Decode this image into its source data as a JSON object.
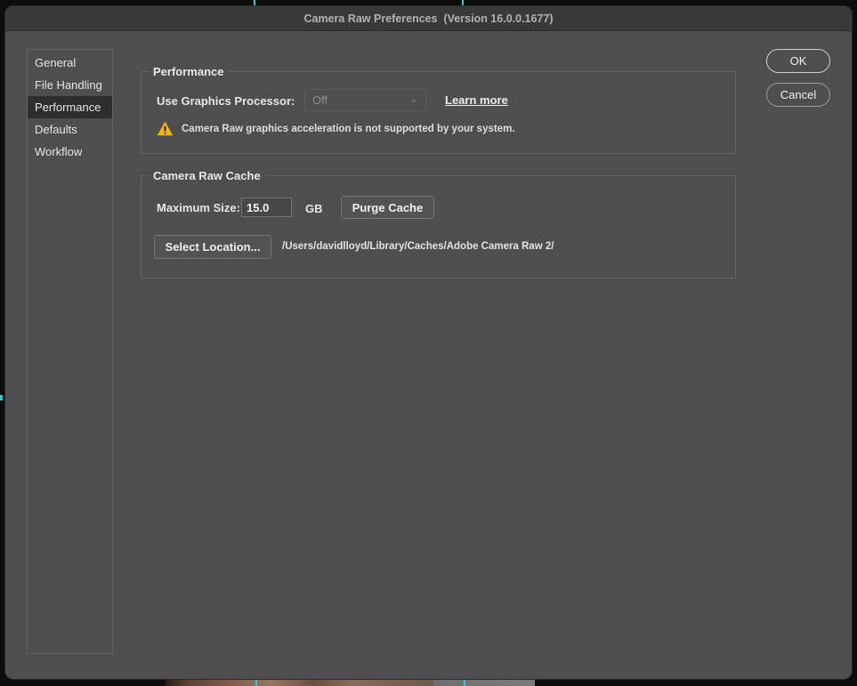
{
  "window": {
    "title": "Camera Raw Preferences  (Version 16.0.0.1677)"
  },
  "sidebar": {
    "items": [
      {
        "label": "General",
        "selected": false
      },
      {
        "label": "File Handling",
        "selected": false
      },
      {
        "label": "Performance",
        "selected": true
      },
      {
        "label": "Defaults",
        "selected": false
      },
      {
        "label": "Workflow",
        "selected": false
      }
    ]
  },
  "actions": {
    "ok_label": "OK",
    "cancel_label": "Cancel"
  },
  "performance": {
    "legend": "Performance",
    "gpu_label": "Use Graphics Processor:",
    "gpu_value": "Off",
    "gpu_dropdown_state": "disabled",
    "chevron_icon": "⌄",
    "learn_more_label": "Learn more",
    "warning_text": "Camera Raw graphics acceleration is not supported by your system."
  },
  "cache": {
    "legend": "Camera Raw Cache",
    "max_size_label": "Maximum Size:",
    "max_size_value": "15.0",
    "unit_label": "GB",
    "purge_label": "Purge Cache",
    "select_location_label": "Select Location...",
    "location_path": "/Users/davidlloyd/Library/Caches/Adobe Camera Raw 2/"
  },
  "colors": {
    "dialog_bg": "#4e4e50",
    "titlebar_bg": "#39393b",
    "selected_item_bg": "#2e2e30",
    "border": "#646466",
    "warning_yellow": "#f2b41c",
    "accent_teal": "#1fd1d6"
  }
}
